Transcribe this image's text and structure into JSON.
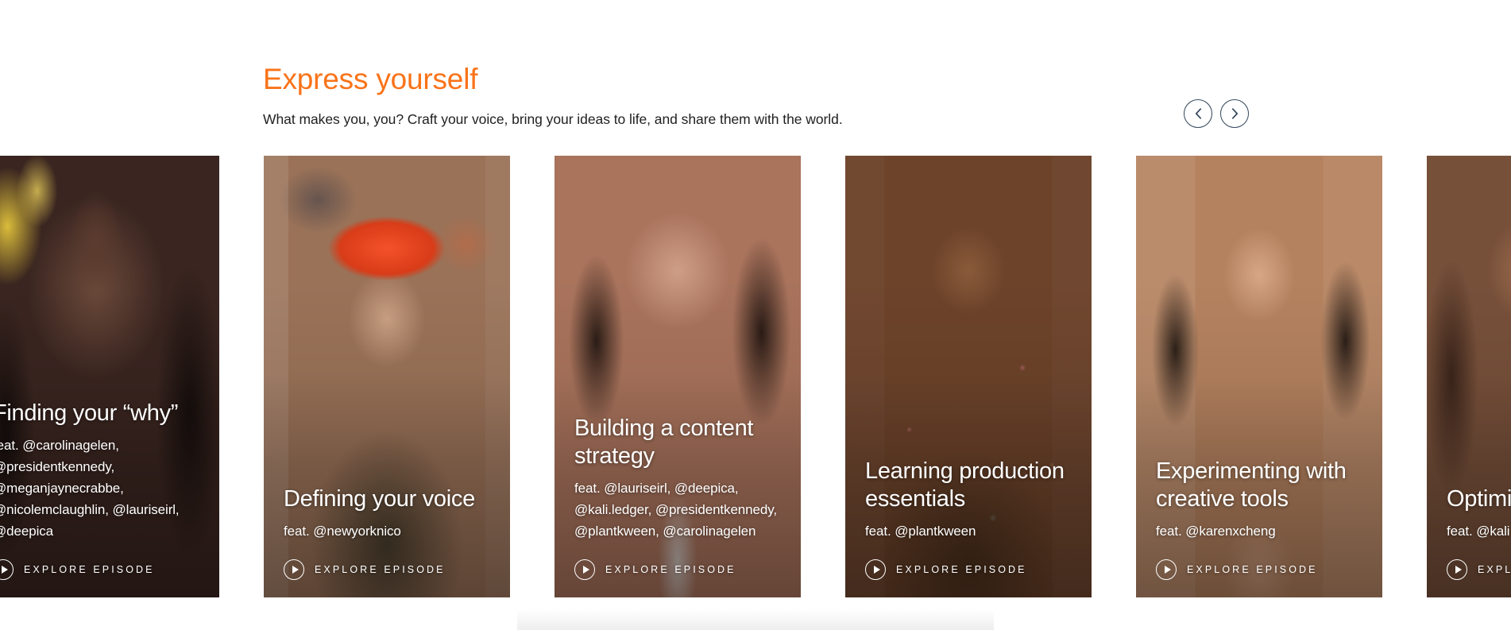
{
  "section": {
    "title": "Express yourself",
    "subtitle": "What makes you, you? Craft your voice, bring your ideas to life, and share them with the world.",
    "title_color": "#f97319",
    "subtitle_color": "#1f1f1f"
  },
  "carousel_nav": {
    "prev_label": "Previous",
    "prev_icon": "chevron-left-icon",
    "next_label": "Next",
    "next_icon": "chevron-right-icon",
    "border_color": "#33475b"
  },
  "cards": [
    {
      "title": "Finding your “why”",
      "feat": "feat. @carolinagelen, @presidentkennedy, @meganjaynecrabbe, @nicolemclaughlin, @lauriseirl, @deepica",
      "cta": "EXPLORE EPISODE",
      "cta_icon": "play-icon",
      "clipped": "left"
    },
    {
      "title": "Defining your voice",
      "feat": "feat. @newyorknico",
      "cta": "EXPLORE EPISODE",
      "cta_icon": "play-icon",
      "clipped": "none"
    },
    {
      "title": "Building a content strategy",
      "feat": "feat. @lauriseirl, @deepica, @kali.ledger, @presidentkennedy, @plantkween, @carolinagelen",
      "cta": "EXPLORE EPISODE",
      "cta_icon": "play-icon",
      "clipped": "none"
    },
    {
      "title": "Learning production essentials",
      "feat": "feat. @plantkween",
      "cta": "EXPLORE EPISODE",
      "cta_icon": "play-icon",
      "clipped": "none"
    },
    {
      "title": "Experimenting with creative tools",
      "feat": "feat. @karenxcheng",
      "cta": "EXPLORE EPISODE",
      "cta_icon": "play-icon",
      "clipped": "none"
    },
    {
      "title": "Optimizing content",
      "feat": "feat. @kali.ledger",
      "cta": "EXPLORE EPISODE",
      "cta_icon": "play-icon",
      "clipped": "right"
    }
  ]
}
